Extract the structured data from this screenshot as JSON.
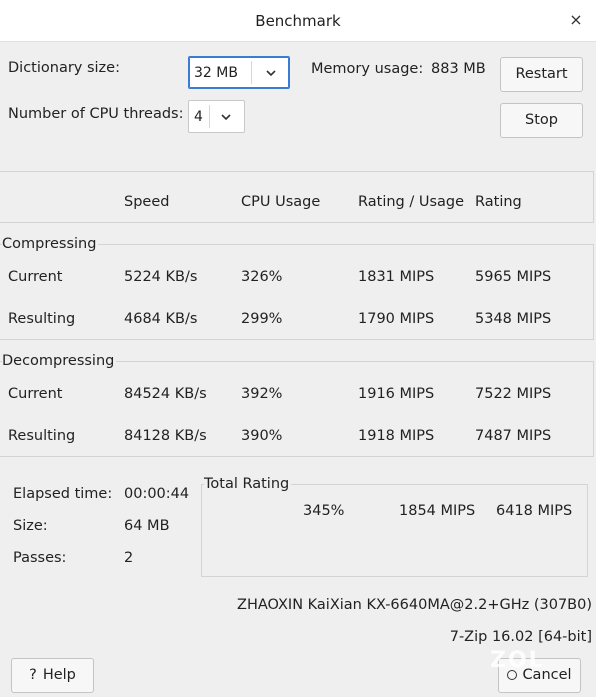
{
  "window": {
    "title": "Benchmark",
    "close_glyph": "×"
  },
  "settings": {
    "dictionary_label": "Dictionary size:",
    "dictionary_value": "32 MB",
    "threads_label": "Number of CPU threads:",
    "threads_value": "4",
    "memory_label": "Memory usage:",
    "memory_value": "883 MB"
  },
  "buttons": {
    "restart": "Restart",
    "stop": "Stop",
    "help": "Help",
    "help_icon": "?",
    "cancel": "Cancel"
  },
  "table": {
    "headers": [
      "Speed",
      "CPU Usage",
      "Rating / Usage",
      "Rating"
    ],
    "compressing": {
      "title": "Compressing",
      "rows": [
        {
          "label": "Current",
          "speed": "5224 KB/s",
          "cpu": "326%",
          "rating_usage": "1831 MIPS",
          "rating": "5965 MIPS"
        },
        {
          "label": "Resulting",
          "speed": "4684 KB/s",
          "cpu": "299%",
          "rating_usage": "1790 MIPS",
          "rating": "5348 MIPS"
        }
      ]
    },
    "decompressing": {
      "title": "Decompressing",
      "rows": [
        {
          "label": "Current",
          "speed": "84524 KB/s",
          "cpu": "392%",
          "rating_usage": "1916 MIPS",
          "rating": "7522 MIPS"
        },
        {
          "label": "Resulting",
          "speed": "84128 KB/s",
          "cpu": "390%",
          "rating_usage": "1918 MIPS",
          "rating": "7487 MIPS"
        }
      ]
    }
  },
  "stats": {
    "elapsed_label": "Elapsed time:",
    "elapsed_value": "00:00:44",
    "size_label": "Size:",
    "size_value": "64 MB",
    "passes_label": "Passes:",
    "passes_value": "2"
  },
  "total": {
    "title": "Total Rating",
    "cpu": "345%",
    "rating_usage": "1854 MIPS",
    "rating": "6418 MIPS"
  },
  "footer": {
    "cpu_info": "ZHAOXIN KaiXian KX-6640MA@2.2+GHz (307B0)",
    "version": "7-Zip 16.02 [64-bit]"
  },
  "watermark": "ZOL"
}
